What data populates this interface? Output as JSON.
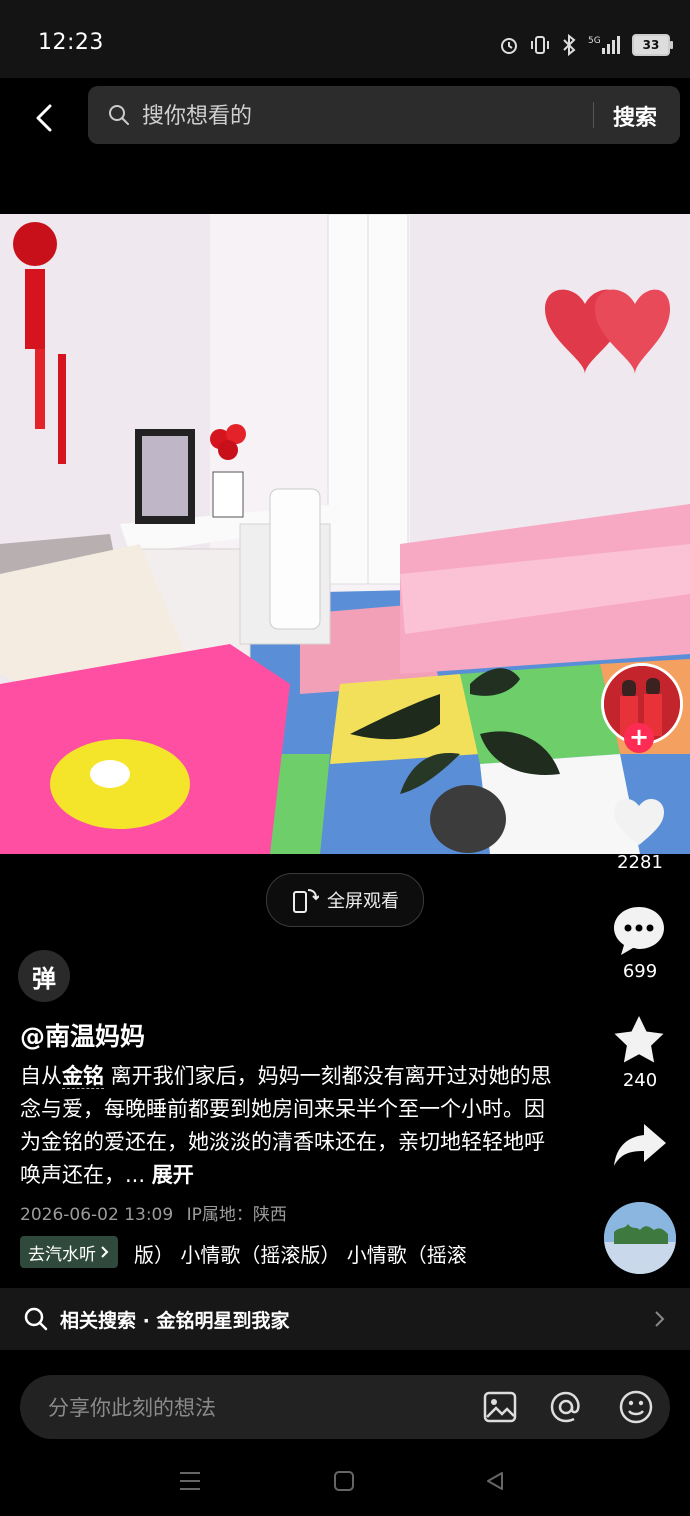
{
  "status": {
    "time": "12:23",
    "battery": "33",
    "network": "5G"
  },
  "search": {
    "placeholder": "搜你想看的",
    "button": "搜索"
  },
  "video": {
    "fullscreen_label": "全屏观看"
  },
  "rail": {
    "likes": "2281",
    "comments": "699",
    "favorites": "240"
  },
  "post": {
    "danmu_label": "弹",
    "username": "@南温妈妈",
    "desc_prefix": "自从",
    "desc_bold": "金铭",
    "desc_rest": " 离开我们家后，妈妈一刻都没有离开过对她的思念与爱，每晚睡前都要到她房间来呆半个至一个小时。因为金铭的爱还在，她淡淡的清香味还在，亲切地轻轻地呼唤声还在，... ",
    "expand": "展开",
    "datetime": "2026-06-02 13:09",
    "ip_location": "IP属地：陕西",
    "music_chip": "去汽水听",
    "music_track": "版）  小情歌（摇滚版）  小情歌（摇滚"
  },
  "related": {
    "label": "相关搜索 · 金铭明星到我家"
  },
  "comment": {
    "placeholder": "分享你此刻的想法"
  },
  "colors": {
    "accent": "#fe2c55",
    "background": "#000000"
  }
}
